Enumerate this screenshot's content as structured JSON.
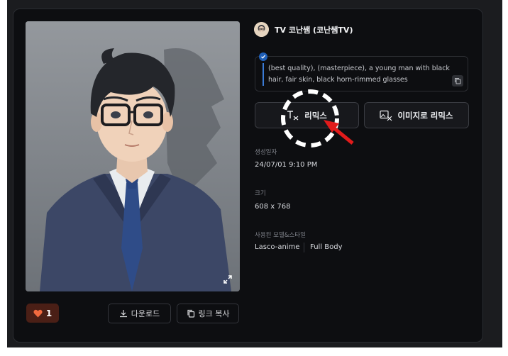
{
  "author": {
    "name": "TV 코난쌤 (코난쌤TV)"
  },
  "prompt": {
    "text": "(best quality), (masterpiece), a young man with black hair, fair skin, black horn-rimmed glasses"
  },
  "buttons": {
    "remix": "리믹스",
    "image_remix": "이미지로 리믹스",
    "download": "다운로드",
    "copy_link": "링크 복사"
  },
  "likes": {
    "count": "1"
  },
  "meta": {
    "created_label": "생성일자",
    "created_value": "24/07/01 9:10 PM",
    "size_label": "크기",
    "size_value": "608 x 768",
    "model_label": "사용된 모델&스타일",
    "models": [
      "Lasco-anime",
      "Full Body"
    ]
  },
  "colors": {
    "background": "#0d0e11",
    "accent": "#3a7bd5",
    "like": "#e0552f",
    "annotation": "#e21b1b"
  }
}
